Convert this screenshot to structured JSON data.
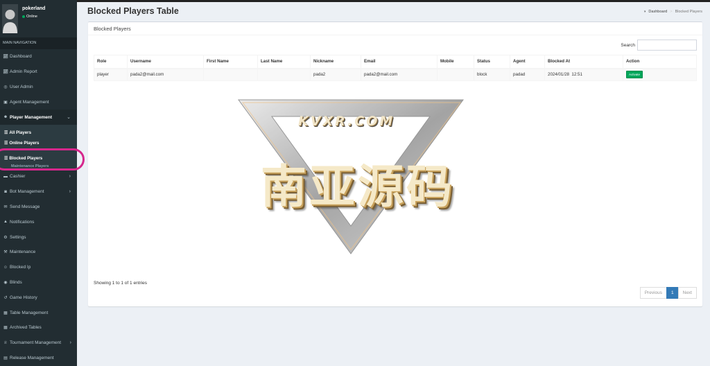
{
  "user": {
    "name": "pokerland",
    "status": "Online"
  },
  "nav": {
    "header": "MAIN NAVIGATION",
    "items": [
      {
        "label": "Dashboard",
        "icon": "chart-icon"
      },
      {
        "label": "Admin Report",
        "icon": "chart-icon"
      },
      {
        "label": "User Admin",
        "icon": "globe-icon"
      },
      {
        "label": "Agent Management",
        "icon": "building-icon"
      },
      {
        "label": "Player Management",
        "icon": "users-icon"
      }
    ],
    "player_sub": [
      {
        "label": "All Players"
      },
      {
        "label": "Online Players"
      },
      {
        "label": "Blocked Players"
      },
      {
        "label": "Maintenance Players"
      }
    ],
    "items2": [
      {
        "label": "Cashier"
      },
      {
        "label": "Bot Management"
      },
      {
        "label": "Send Message"
      },
      {
        "label": "Notifications"
      },
      {
        "label": "Settings"
      },
      {
        "label": "Maintenance"
      },
      {
        "label": "Blocked Ip"
      },
      {
        "label": "Blinds"
      },
      {
        "label": "Game History"
      },
      {
        "label": "Table Management"
      },
      {
        "label": "Archived Tables"
      },
      {
        "label": "Tournament Management"
      },
      {
        "label": "Release Management"
      }
    ]
  },
  "page": {
    "title": "Blocked Players Table",
    "breadcrumb": [
      "Dashboard",
      "Blocked Players"
    ]
  },
  "box": {
    "title": "Blocked Players",
    "search_label": "Search",
    "search_value": ""
  },
  "table": {
    "columns": [
      "Role",
      "Username",
      "First Name",
      "Last Name",
      "Nickname",
      "Email",
      "Mobile",
      "Status",
      "Agent",
      "Blocked At",
      "Action"
    ],
    "rows": [
      {
        "role": "player",
        "username": "pada2@mail.com",
        "first_name": "",
        "last_name": "",
        "nickname": "pada2",
        "email": "pada2@mail.com",
        "mobile": "",
        "status": "block",
        "agent": "padad",
        "blocked_at": "2024/01/28  12:51",
        "action": "Activate"
      }
    ]
  },
  "footer": {
    "info": "Showing 1 to 1 of 1 entries",
    "prev": "Previous",
    "page": "1",
    "next": "Next"
  },
  "watermark": {
    "site": "KVXR.COM",
    "brand": "南亚源码"
  },
  "colors": {
    "sidebar": "#222d32",
    "accent": "#337ab7",
    "success": "#00a65a",
    "highlight": "#d6278c"
  }
}
